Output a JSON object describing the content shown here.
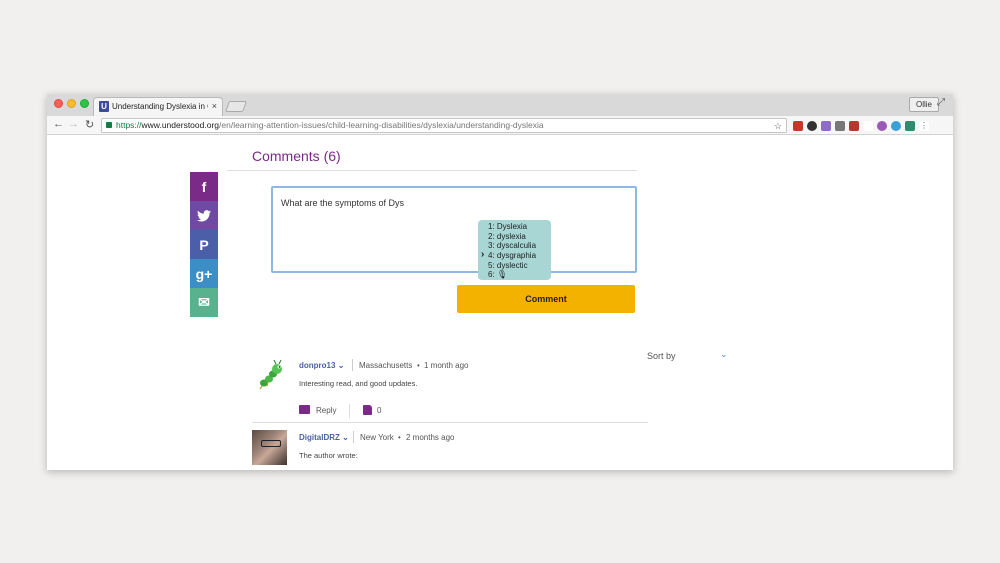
{
  "browser": {
    "tab_title": "Understanding Dyslexia in Chi",
    "tab_favicon": "U",
    "tab_close": "×",
    "profile_name": "Ollie",
    "url_scheme": "https://",
    "url_host": "www.understood.org",
    "url_path": "/en/learning-attention-issues/child-learning-disabilities/dyslexia/understanding-dyslexia"
  },
  "page": {
    "comments_title": "Comments (6)",
    "share": [
      {
        "icon": "facebook-icon",
        "glyph": "f"
      },
      {
        "icon": "twitter-icon",
        "glyph": "t"
      },
      {
        "icon": "pinterest-icon",
        "glyph": "P"
      },
      {
        "icon": "google-plus-icon",
        "glyph": "g+"
      },
      {
        "icon": "email-icon",
        "glyph": "✉"
      }
    ],
    "comment_input_value": "What are the symptoms of Dys",
    "suggestions": [
      {
        "label": "1: Dyslexia",
        "selected": false
      },
      {
        "label": "2: dyslexia",
        "selected": false
      },
      {
        "label": "3: dyscalculia",
        "selected": false
      },
      {
        "label": "4: dysgraphia",
        "selected": true
      },
      {
        "label": "5: dyslectic",
        "selected": false
      },
      {
        "label": "6: 🎙",
        "selected": false
      }
    ],
    "comment_button": "Comment",
    "sort_label": "Sort by",
    "comments": [
      {
        "author": "donpro13",
        "location": "Massachusetts",
        "time": "1 month ago",
        "body": "Interesting read, and good updates.",
        "reply_label": "Reply",
        "likes": "0"
      },
      {
        "author": "DigitalDRZ",
        "location": "New York",
        "time": "2 months ago",
        "body": "The author wrote:"
      }
    ]
  },
  "colors": {
    "brand_purple": "#7a2a87",
    "comment_button": "#f4b200",
    "suggestion_bg": "#a7d6d5",
    "input_border": "#8fb8e0"
  }
}
